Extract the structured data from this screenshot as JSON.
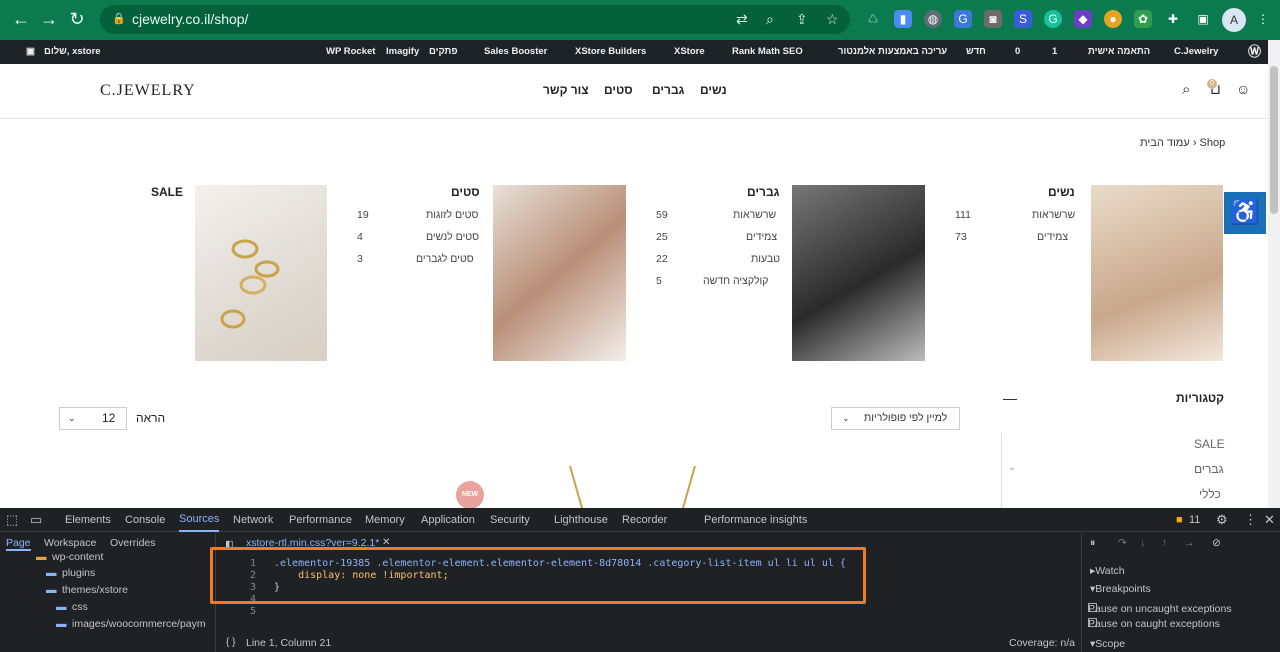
{
  "browser": {
    "url": "cjewelry.co.il/shop/",
    "avatar_letter": "A"
  },
  "wp_admin_bar": {
    "greeting": "שלום, xstore",
    "items": [
      "WP Rocket",
      "Imagify",
      "פתקים",
      "Sales Booster",
      "XStore Builders",
      "XStore",
      "Rank Math SEO",
      "עריכה באמצעות אלמנטור",
      "חדש",
      "0",
      "1",
      "התאמה אישית",
      "C.Jewelry"
    ]
  },
  "header": {
    "logo": "C.JEWELRY",
    "menu": [
      "נשים",
      "גברים",
      "סטים",
      "צור קשר"
    ],
    "cart_count": "0"
  },
  "breadcrumb": "עמוד הבית › Shop",
  "categories": [
    {
      "title": "נשים",
      "subs": [
        {
          "name": "שרשראות",
          "count": "111"
        },
        {
          "name": "צמידים",
          "count": "73"
        }
      ]
    },
    {
      "title": "גברים",
      "subs": [
        {
          "name": "שרשראות",
          "count": "59"
        },
        {
          "name": "צמידים",
          "count": "25"
        },
        {
          "name": "טבעות",
          "count": "22"
        },
        {
          "name": "קולקציה חדשה",
          "count": "5"
        }
      ]
    },
    {
      "title": "סטים",
      "subs": [
        {
          "name": "סטים לזוגות",
          "count": "19"
        },
        {
          "name": "סטים לנשים",
          "count": "4"
        },
        {
          "name": "סטים לגברים",
          "count": "3"
        }
      ]
    },
    {
      "title": "SALE",
      "subs": []
    }
  ],
  "toolbar": {
    "sort_label": "למיין לפי פופולריות",
    "show_label": "הראה",
    "show_value": "12"
  },
  "sidebar": {
    "title": "קטגוריות",
    "items": [
      "SALE",
      "גברים",
      "כללי"
    ]
  },
  "product_badge": "NEW",
  "devtools": {
    "tabs": [
      "Elements",
      "Console",
      "Sources",
      "Network",
      "Performance",
      "Memory",
      "Application",
      "Security",
      "Lighthouse",
      "Recorder",
      "Performance insights"
    ],
    "issues_count": "11",
    "left_tabs": [
      "Page",
      "Workspace",
      "Overrides"
    ],
    "file_tree": [
      "wp-content",
      "plugins",
      "themes/xstore",
      "css",
      "images/woocommerce/paym"
    ],
    "open_file": "xstore-rtl.min.css?ver=9.2.1*",
    "code": [
      ".elementor-19385 .elementor-element.elementor-element-8d78014 .category-list-item ul li ul ul {",
      "    display: none !important;",
      "}",
      "",
      ""
    ],
    "status_position": "Line 1, Column 21",
    "coverage": "Coverage: n/a",
    "right_panel": [
      "Watch",
      "Breakpoints",
      "Pause on uncaught exceptions",
      "Pause on caught exceptions",
      "Scope"
    ]
  }
}
